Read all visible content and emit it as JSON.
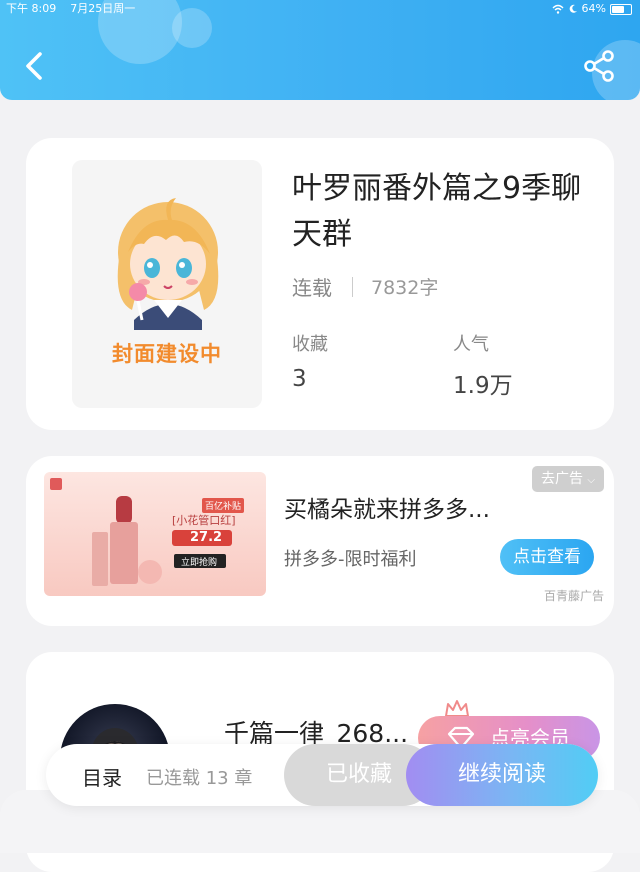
{
  "status_bar": {
    "time": "下午 8:09",
    "date": "7月25日周一",
    "battery": "64%"
  },
  "book": {
    "cover_text": "封面建设中",
    "title": "叶罗丽番外篇之9季聊天群",
    "status": "连载",
    "word_count": "7832字",
    "stats": [
      {
        "label": "收藏",
        "value": "3"
      },
      {
        "label": "人气",
        "value": "1.9万"
      }
    ]
  },
  "ad": {
    "title": "买橘朵就来拼多多...",
    "subtitle": "拼多多-限时福利",
    "button_label": "点击查看",
    "close_label": "去广告",
    "source": "百青藤广告",
    "image_texts": {
      "promo_tag": "百亿补贴",
      "product": "[小花管口红]",
      "price": "27.2",
      "buy": "立即抢购"
    }
  },
  "author": {
    "name": "千篇一律_268...",
    "vip_button": "点亮会员"
  },
  "bottom_bar": {
    "toc_label": "目录",
    "chapters": "已连载 13 章",
    "collected": "已收藏",
    "continue": "继续阅读"
  },
  "colors": {
    "accent": "#3fb0f3",
    "cover_text": "#f28b2d",
    "ad_button": "#2ba6f1"
  },
  "icons": [
    "back-arrow-icon",
    "share-icon",
    "wifi-icon",
    "moon-icon",
    "battery-icon",
    "dropdown-chevron-icon",
    "crown-icon",
    "diamond-icon"
  ]
}
